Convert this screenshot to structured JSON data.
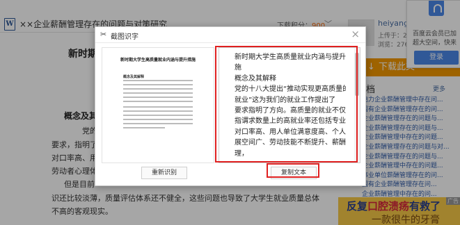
{
  "topbar": {
    "doc_icon": "W",
    "title": "××企业薪酬管理存在的问题与对策研究",
    "download_points_label": "下载积分：",
    "download_points_value": "900",
    "chevron": "﹀"
  },
  "document": {
    "heading": "新时期",
    "section_title": "概念及其",
    "lines": [
      "党的十八",
      "要求，指明了方",
      "对口率高、用人",
      "劳动者心理体",
      "但是目前",
      "识还比较淡薄，质量评估体系还不健全，这些问题也导致了大学生就业质量总体",
      "不高的客观现实。"
    ]
  },
  "sidebar": {
    "username": "heiyang1",
    "meta_1": "上传于：20",
    "meta_2": "浏览：2768",
    "download_button": "下载此文",
    "related_heading": "文档",
    "more": "更多",
    "related": [
      "电力企业薪酬管理中存在问...",
      "国有企业薪酬管理存在的问...",
      "企业薪酬管理存在的问题与...",
      "企业薪酬管理存在的问题与...",
      "企业薪酬管理中存在的问题...",
      "企业薪酬管理存在的问题与对...",
      "企业薪酬管理存在的问题与...",
      "企业薪酬管理中存在的问题...",
      "事业单位薪酬管理存在的问...",
      "国有企业薪酬管理存在问...",
      "企业薪酬管理中存在的问...",
      "企业薪酬管理存在的问题..."
    ]
  },
  "notice": {
    "line1": "百度云会员已加",
    "line2": "超大空间，快来",
    "login": "登录"
  },
  "ad": {
    "text_a": "反复",
    "text_red": "口腔溃疡",
    "text_b": "有救了",
    "text_2": "一款很牛的牙膏",
    "tag": "广告"
  },
  "dialog": {
    "title": "截图识字",
    "close": "×",
    "thumbnail_title": "新时期大学生高质量就业内涵与提升措施",
    "thumbnail_section": "概念及其解释",
    "reidentify_button": "重新识别",
    "copy_button": "复制文本",
    "ocr_lines": [
      "新时期大学生高质量就业内涵与提升措",
      "施",
      "概念及其解释",
      "党的十八大提出“推动实现更高质量的",
      "就业”这为我们的就业工作提出了",
      "要求指明了方向。高质量的就业不仅是",
      "指谓求数量上的高就业率还包括专业：",
      "对口率高、用人单位满意度高、个人发",
      "展空间广、劳动技能不断提升、薪酬合",
      "理，"
    ]
  }
}
